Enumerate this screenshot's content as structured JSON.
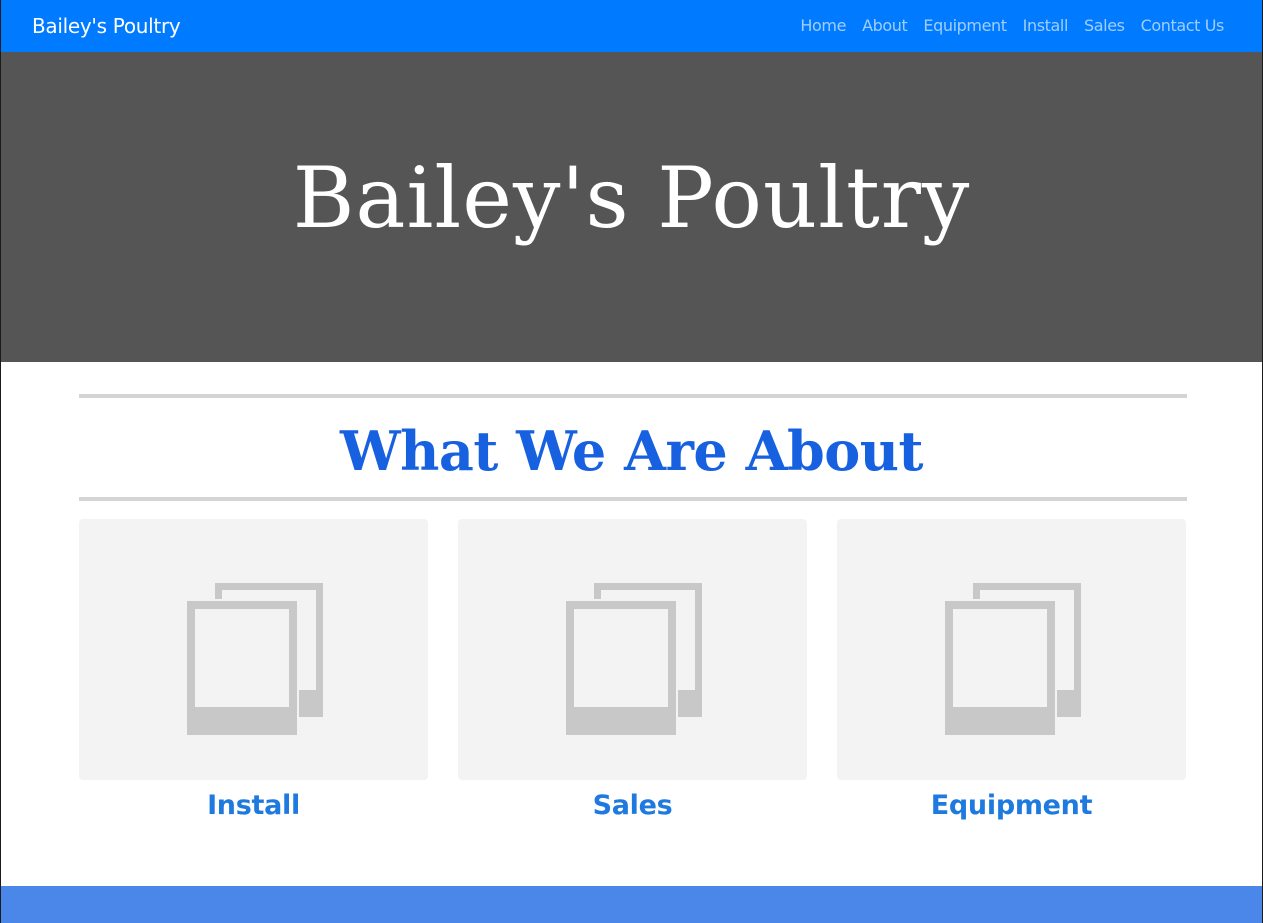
{
  "navbar": {
    "brand": "Bailey's Poultry",
    "links": [
      "Home",
      "About",
      "Equipment",
      "Install",
      "Sales",
      "Contact Us"
    ]
  },
  "hero": {
    "title": "Bailey's Poultry"
  },
  "section": {
    "title": "What We Are About"
  },
  "cards": [
    {
      "label": "Install",
      "image_icon": "image-placeholder-icon"
    },
    {
      "label": "Sales",
      "image_icon": "image-placeholder-icon"
    },
    {
      "label": "Equipment",
      "image_icon": "image-placeholder-icon"
    }
  ],
  "colors": {
    "navbar": "#007bff",
    "hero": "#555555",
    "heading": "#1761e0",
    "card_label": "#1f7ae0",
    "footer": "#4a87e8"
  }
}
